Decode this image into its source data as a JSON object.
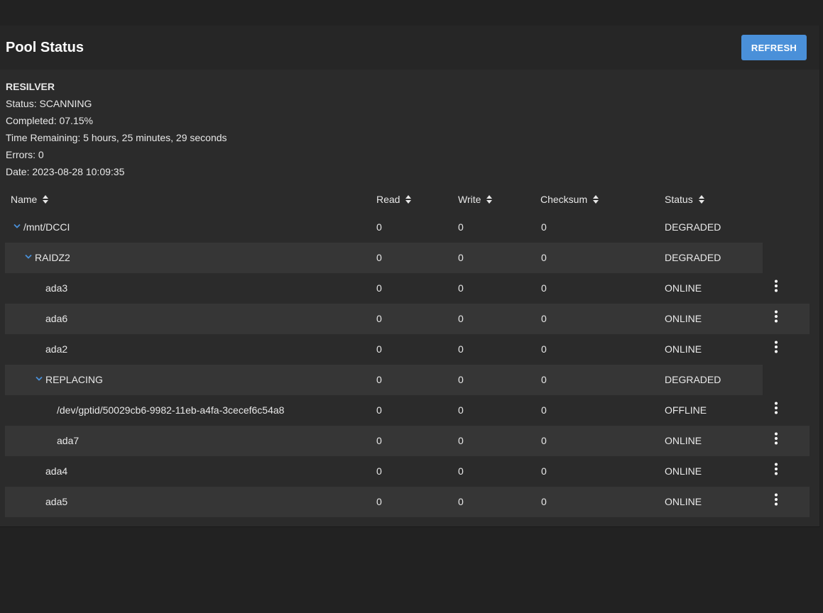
{
  "card": {
    "title": "Pool Status",
    "refresh_label": "REFRESH"
  },
  "scan": {
    "heading": "RESILVER",
    "status": "Status: SCANNING",
    "completed": "Completed: 07.15%",
    "time_remaining": "Time Remaining: 5 hours, 25 minutes, 29 seconds",
    "errors": "Errors: 0",
    "date": "Date: 2023-08-28 10:09:35"
  },
  "table": {
    "columns": [
      "Name",
      "Read",
      "Write",
      "Checksum",
      "Status"
    ],
    "rows": [
      {
        "name": "/mnt/DCCI",
        "read": "0",
        "write": "0",
        "checksum": "0",
        "status": "DEGRADED",
        "expanded": true,
        "menu": false
      },
      {
        "name": "RAIDZ2",
        "read": "0",
        "write": "0",
        "checksum": "0",
        "status": "DEGRADED",
        "expanded": true,
        "menu": false
      },
      {
        "name": "ada3",
        "read": "0",
        "write": "0",
        "checksum": "0",
        "status": "ONLINE",
        "menu": true
      },
      {
        "name": "ada6",
        "read": "0",
        "write": "0",
        "checksum": "0",
        "status": "ONLINE",
        "menu": true
      },
      {
        "name": "ada2",
        "read": "0",
        "write": "0",
        "checksum": "0",
        "status": "ONLINE",
        "menu": true
      },
      {
        "name": "REPLACING",
        "read": "0",
        "write": "0",
        "checksum": "0",
        "status": "DEGRADED",
        "expanded": true,
        "menu": false
      },
      {
        "name": "/dev/gptid/50029cb6-9982-11eb-a4fa-3cecef6c54a8",
        "read": "0",
        "write": "0",
        "checksum": "0",
        "status": "OFFLINE",
        "menu": true
      },
      {
        "name": "ada7",
        "read": "0",
        "write": "0",
        "checksum": "0",
        "status": "ONLINE",
        "menu": true
      },
      {
        "name": "ada4",
        "read": "0",
        "write": "0",
        "checksum": "0",
        "status": "ONLINE",
        "menu": true
      },
      {
        "name": "ada5",
        "read": "0",
        "write": "0",
        "checksum": "0",
        "status": "ONLINE",
        "menu": true
      }
    ]
  },
  "icons": {
    "sort": "sort-icon",
    "expand": "chevron-down-icon",
    "menu": "more-vert-icon"
  },
  "colors": {
    "accent": "#4a90d9",
    "background": "#222222",
    "card": "#2b2b2b",
    "row_shade": "#363636"
  }
}
